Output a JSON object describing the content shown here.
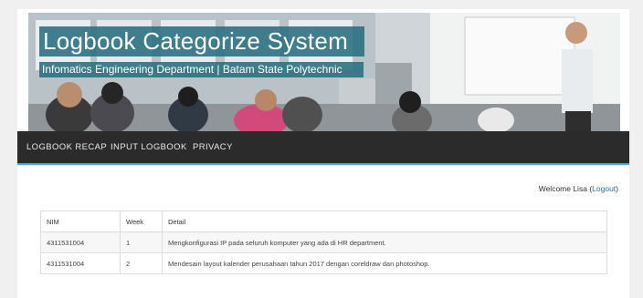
{
  "banner": {
    "title": "Logbook Categorize System",
    "subtitle": "Infomatics Engineering Department | Batam State Polytechnic"
  },
  "nav": {
    "items": [
      {
        "label": "LOGBOOK RECAP"
      },
      {
        "label": "INPUT LOGBOOK"
      },
      {
        "label": "PRIVACY"
      }
    ]
  },
  "user": {
    "welcome": "Welcome Lisa",
    "logout_open": "(",
    "logout": "Logout",
    "logout_close": ")"
  },
  "table": {
    "headers": [
      "NIM",
      "Week",
      "Detail"
    ],
    "rows": [
      {
        "nim": "4311531004",
        "week": "1",
        "detail": "Mengkonfigurasi IP pada seluruh komputer yang ada di HR department."
      },
      {
        "nim": "4311531004",
        "week": "2",
        "detail": "Mendesain layout kalender perusahaan tahun 2017 dengan coreldraw dan photoshop."
      }
    ]
  },
  "colors": {
    "nav_bg": "#2b2b2b",
    "nav_accent": "#3bb0c9",
    "title_bg": "#286e80",
    "link": "#2a6f9c"
  }
}
